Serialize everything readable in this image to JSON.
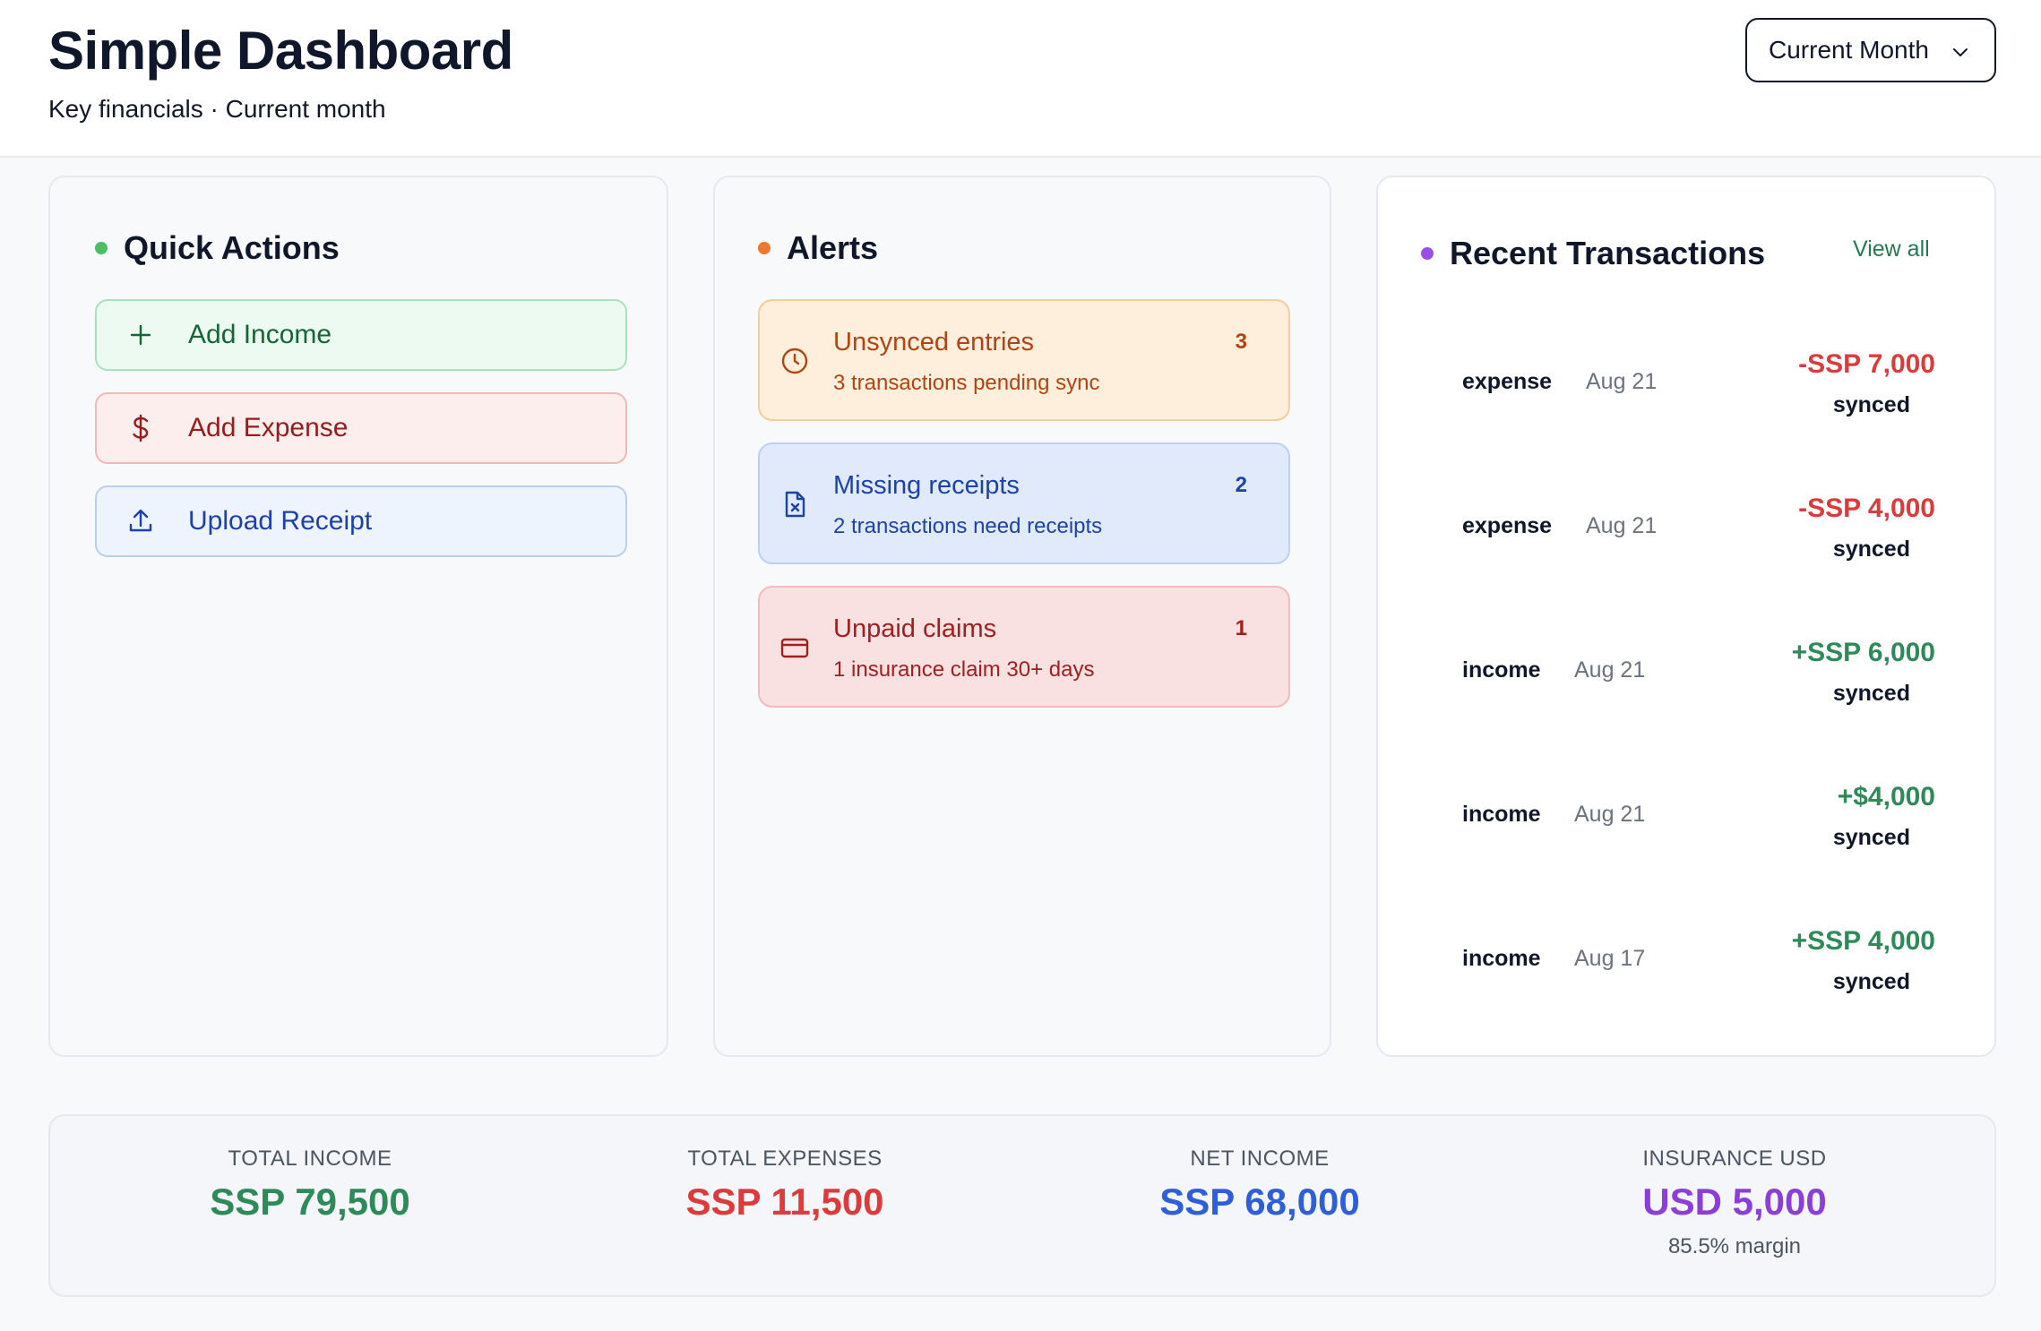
{
  "header": {
    "title": "Simple Dashboard",
    "subtitle": "Key financials · Current month",
    "period_select": {
      "value": "Current Month"
    }
  },
  "quick_actions": {
    "title": "Quick Actions",
    "dot_color": "#4cbf66",
    "items": [
      {
        "label": "Add Income",
        "icon": "plus-icon"
      },
      {
        "label": "Add Expense",
        "icon": "dollar-icon"
      },
      {
        "label": "Upload Receipt",
        "icon": "upload-icon"
      }
    ]
  },
  "alerts": {
    "title": "Alerts",
    "dot_color": "#ea7a2f",
    "items": [
      {
        "title": "Unsynced entries",
        "description": "3 transactions pending sync",
        "count": "3",
        "icon": "clock-icon"
      },
      {
        "title": "Missing receipts",
        "description": "2 transactions need receipts",
        "count": "2",
        "icon": "file-x-icon"
      },
      {
        "title": "Unpaid claims",
        "description": "1 insurance claim 30+ days",
        "count": "1",
        "icon": "credit-card-icon"
      }
    ]
  },
  "transactions": {
    "title": "Recent Transactions",
    "dot_color": "#9b4fe8",
    "view_all": "View all",
    "items": [
      {
        "type": "expense",
        "date": "Aug 21",
        "amount": "-SSP 7,000",
        "status": "synced"
      },
      {
        "type": "expense",
        "date": "Aug 21",
        "amount": "-SSP 4,000",
        "status": "synced"
      },
      {
        "type": "income",
        "date": "Aug 21",
        "amount": "+SSP 6,000",
        "status": "synced"
      },
      {
        "type": "income",
        "date": "Aug 21",
        "amount": "+$4,000",
        "status": "synced"
      },
      {
        "type": "income",
        "date": "Aug 17",
        "amount": "+SSP 4,000",
        "status": "synced"
      }
    ]
  },
  "summary": {
    "total_income": {
      "label": "TOTAL INCOME",
      "value": "SSP 79,500"
    },
    "total_expenses": {
      "label": "TOTAL EXPENSES",
      "value": "SSP 11,500"
    },
    "net_income": {
      "label": "NET INCOME",
      "value": "SSP 68,000"
    },
    "insurance_usd": {
      "label": "INSURANCE USD",
      "value": "USD 5,000",
      "note": "85.5% margin"
    }
  },
  "colors": {
    "income": "#2f8a5a",
    "expense": "#dc3b3b",
    "net": "#2f5fd8",
    "insurance": "#8b3fd6"
  }
}
